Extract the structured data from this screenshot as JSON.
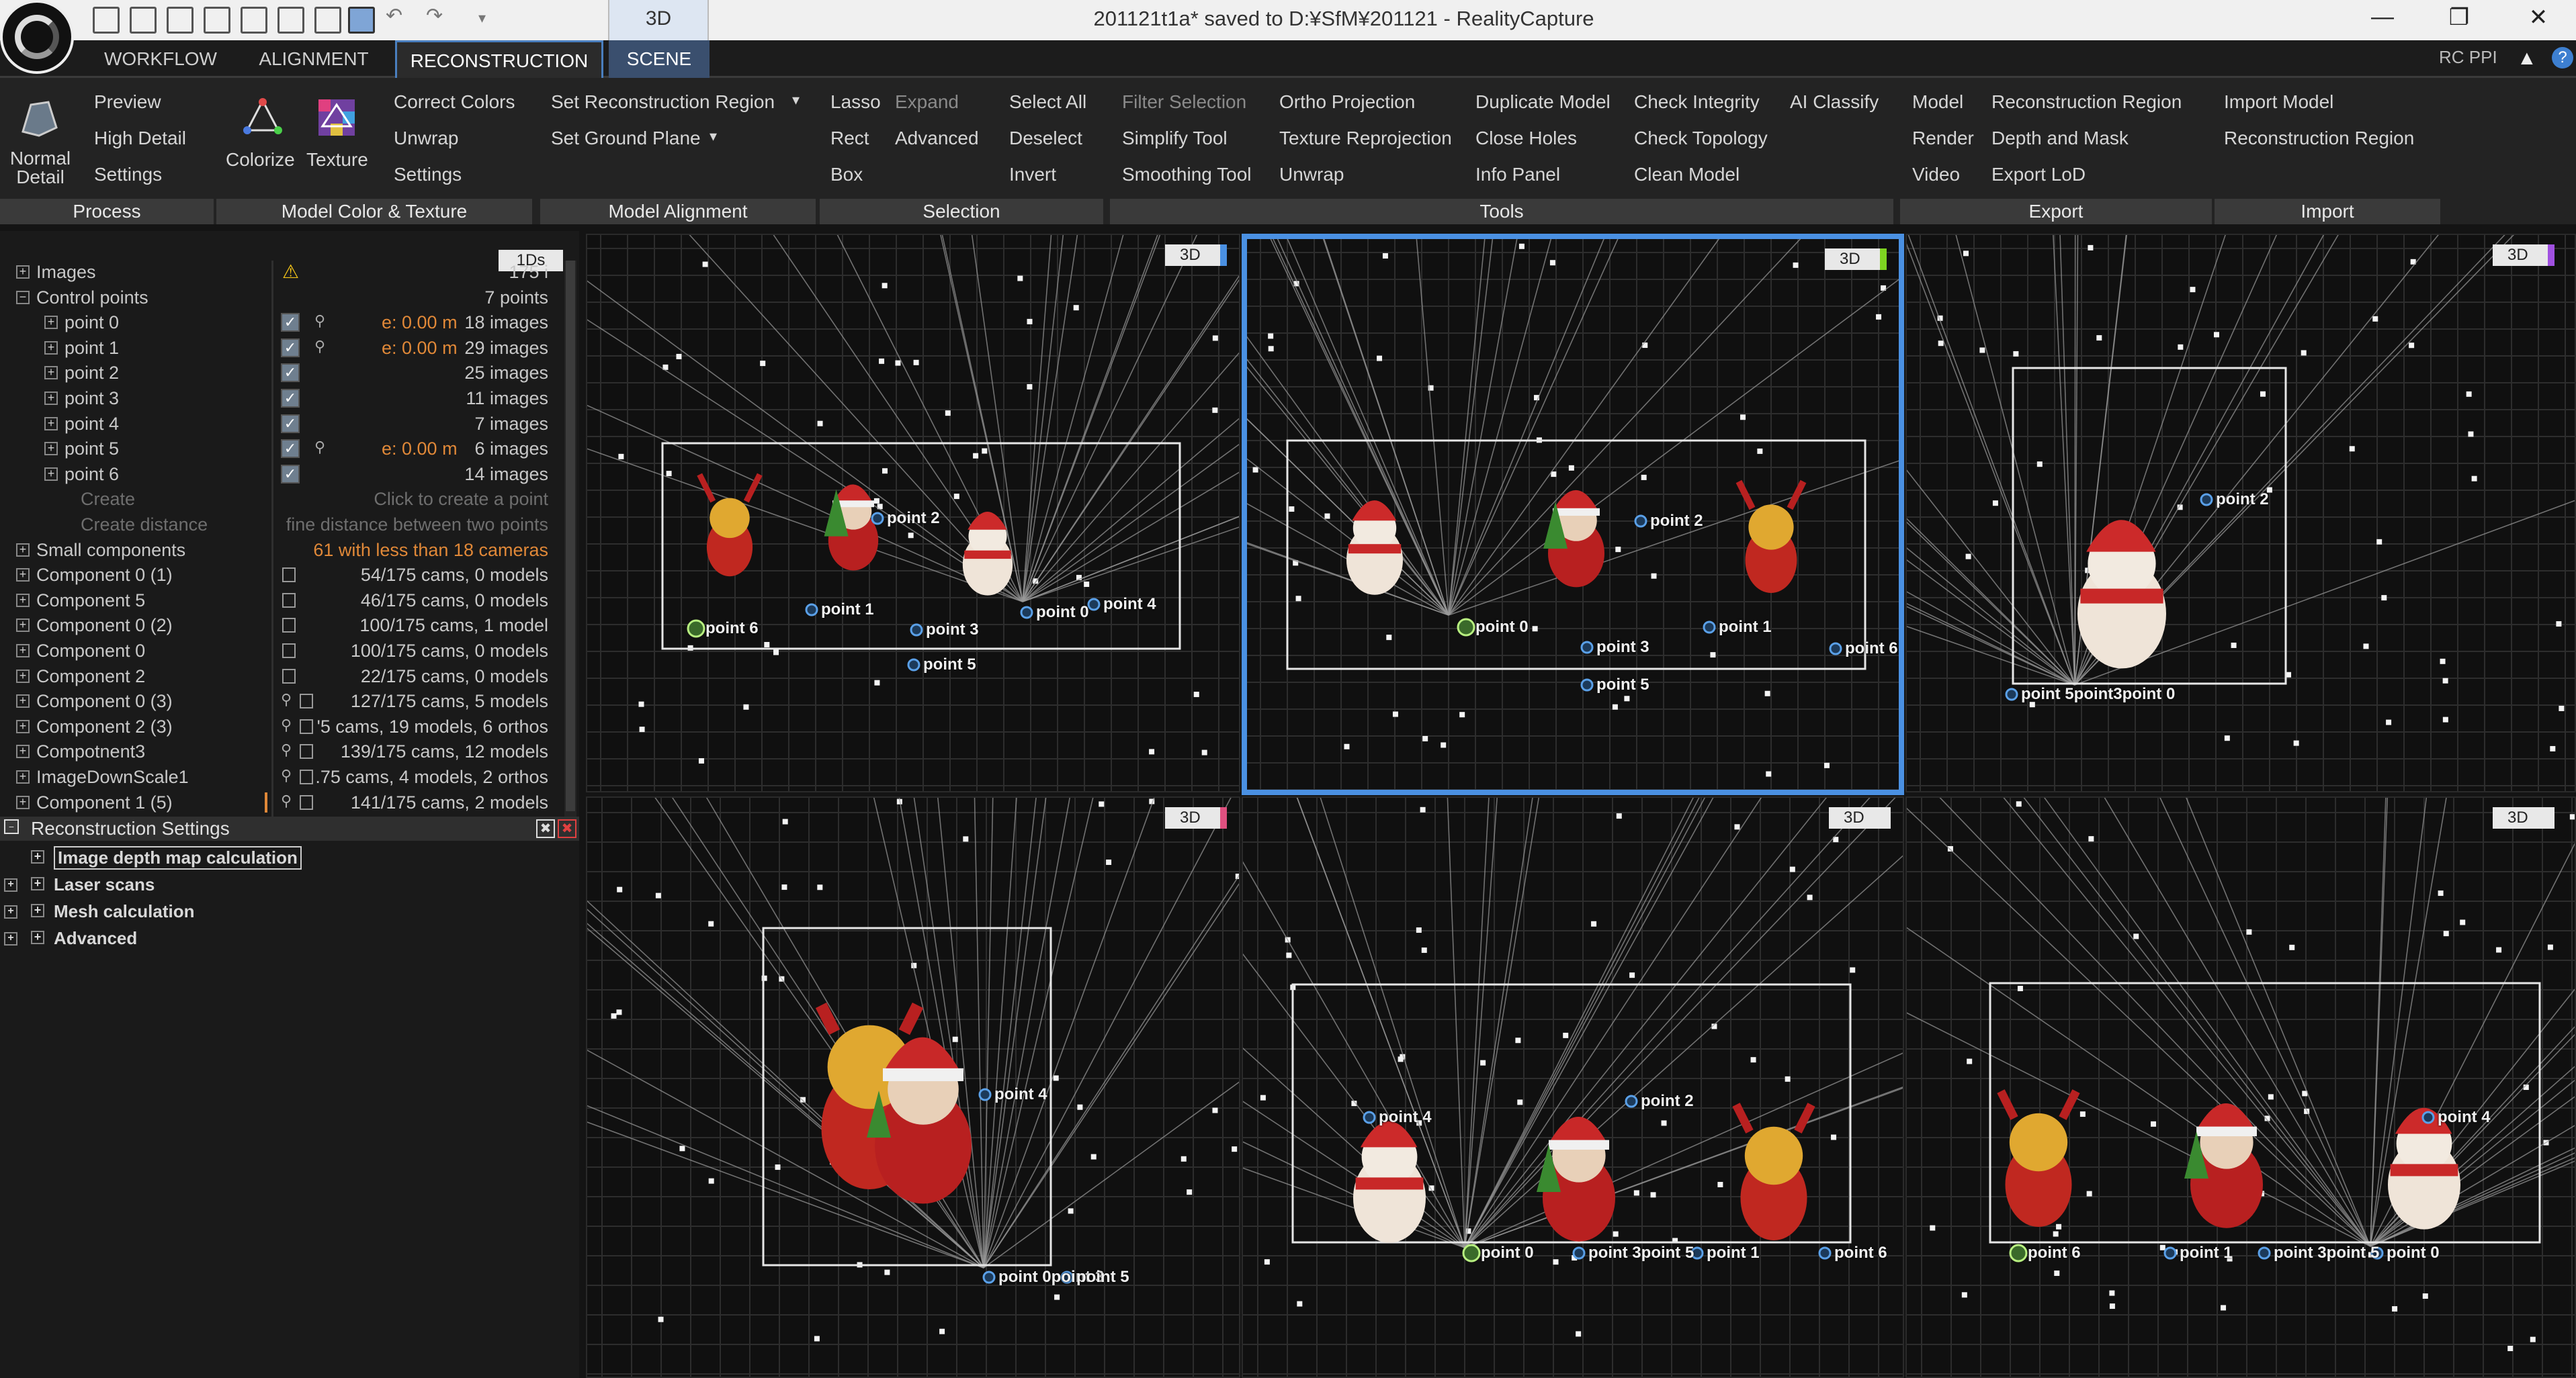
{
  "titlebar": {
    "tab_3d": "3D",
    "window_title": "201121t1a* saved to D:¥SfM¥201121 - RealityCapture",
    "minimize": "—",
    "restore": "❐",
    "close": "✕"
  },
  "menubar": {
    "tabs": [
      "WORKFLOW",
      "ALIGNMENT",
      "RECONSTRUCTION",
      "SCENE"
    ],
    "active_tab": "RECONSTRUCTION",
    "rc_ppi": "RC PPI"
  },
  "ribbon": {
    "process": {
      "normal_detail": "Normal Detail",
      "preview": "Preview",
      "high_detail": "High Detail",
      "settings": "Settings",
      "label": "Process"
    },
    "color_texture": {
      "colorize": "Colorize",
      "texture": "Texture",
      "correct_colors": "Correct Colors",
      "unwrap": "Unwrap",
      "settings": "Settings",
      "label": "Model Color & Texture"
    },
    "alignment": {
      "set_region": "Set Reconstruction Region",
      "set_ground": "Set Ground Plane",
      "label": "Model Alignment"
    },
    "selection": {
      "lasso": "Lasso",
      "expand": "Expand",
      "rect": "Rect",
      "advanced": "Advanced",
      "box": "Box",
      "select_all": "Select All",
      "deselect": "Deselect",
      "invert": "Invert",
      "label": "Selection"
    },
    "tools": {
      "filter_selection": "Filter Selection",
      "simplify": "Simplify Tool",
      "smoothing": "Smoothing Tool",
      "ortho": "Ortho Projection",
      "texture_reprojection": "Texture Reprojection",
      "unwrap": "Unwrap",
      "duplicate": "Duplicate Model",
      "close_holes": "Close Holes",
      "info_panel": "Info Panel",
      "check_integrity": "Check Integrity",
      "check_topology": "Check Topology",
      "clean_model": "Clean Model",
      "ai_classify": "AI Classify",
      "label": "Tools"
    },
    "export": {
      "model": "Model",
      "render": "Render",
      "video": "Video",
      "recon_region": "Reconstruction Region",
      "depth_mask": "Depth and Mask",
      "export_lod": "Export LoD",
      "label": "Export"
    },
    "import": {
      "import_model": "Import Model",
      "recon_region": "Reconstruction Region",
      "label": "Import"
    }
  },
  "tree": {
    "badge": "1Ds",
    "rows": [
      {
        "name": "Images",
        "value": "175 i",
        "indent": 0,
        "kind": "warn",
        "plus": "+"
      },
      {
        "name": "Control points",
        "value": "7 points",
        "indent": 0,
        "kind": "none",
        "plus": "−"
      },
      {
        "name": "point 0",
        "value": "18 images",
        "err": "e: 0.00 m",
        "indent": 1,
        "kind": "cbpin",
        "plus": "+"
      },
      {
        "name": "point 1",
        "value": "29 images",
        "err": "e: 0.00 m",
        "indent": 1,
        "kind": "cbpin",
        "plus": "+"
      },
      {
        "name": "point 2",
        "value": "25 images",
        "indent": 1,
        "kind": "cb",
        "plus": "+"
      },
      {
        "name": "point 3",
        "value": "11 images",
        "indent": 1,
        "kind": "cb",
        "plus": "+"
      },
      {
        "name": "point 4",
        "value": "7 images",
        "indent": 1,
        "kind": "cb",
        "plus": "+"
      },
      {
        "name": "point 5",
        "value": "6 images",
        "err": "e: 0.00 m",
        "indent": 1,
        "kind": "cbpin",
        "plus": "+"
      },
      {
        "name": "point 6",
        "value": "14 images",
        "indent": 1,
        "kind": "cb",
        "plus": "+"
      },
      {
        "name": "Create",
        "value": "Click to create a point",
        "indent": 2,
        "kind": "grey",
        "plus": ""
      },
      {
        "name": "Create distance",
        "value": "fine distance between two points",
        "indent": 2,
        "kind": "grey",
        "plus": ""
      },
      {
        "name": "Small components",
        "value": "61 with less than 18 cameras",
        "indent": 0,
        "kind": "orange",
        "plus": "+"
      },
      {
        "name": "Component 0 (1)",
        "value": "54/175 cams, 0 models",
        "indent": 0,
        "kind": "model",
        "plus": "+"
      },
      {
        "name": "Component 5",
        "value": "46/175 cams, 0 models",
        "indent": 0,
        "kind": "model",
        "plus": "+"
      },
      {
        "name": "Component 0 (2)",
        "value": "100/175 cams, 1 model",
        "indent": 0,
        "kind": "model",
        "plus": "+"
      },
      {
        "name": "Component 0",
        "value": "100/175 cams, 0 models",
        "indent": 0,
        "kind": "model",
        "plus": "+"
      },
      {
        "name": "Component 2",
        "value": "22/175 cams, 0 models",
        "indent": 0,
        "kind": "model",
        "plus": "+"
      },
      {
        "name": "Component 0 (3)",
        "value": "127/175 cams, 5 models",
        "indent": 0,
        "kind": "pinmodel",
        "plus": "+"
      },
      {
        "name": "Component 2 (3)",
        "value": "'5 cams, 19 models, 6 orthos",
        "indent": 0,
        "kind": "pinmodel",
        "plus": "+"
      },
      {
        "name": "Compotnent3",
        "value": "139/175 cams, 12 models",
        "indent": 0,
        "kind": "pinmodel",
        "plus": "+"
      },
      {
        "name": "ImageDownScale1",
        "value": ".75 cams, 4 models, 2 orthos",
        "indent": 0,
        "kind": "pinmodel",
        "plus": "+"
      },
      {
        "name": "Component 1 (5)",
        "value": "141/175 cams, 2 models",
        "indent": 0,
        "kind": "pinmodel",
        "plus": "+"
      }
    ]
  },
  "settings": {
    "title": "Reconstruction Settings",
    "rows": [
      "Image depth map calculation",
      "Laser scans",
      "Mesh calculation",
      "Advanced"
    ]
  },
  "viewports": {
    "badge": "3D",
    "labels": {
      "p0": "point 0",
      "p1": "point 1",
      "p2": "point 2",
      "p3": "point 3",
      "p4": "point 4",
      "p5": "point 5",
      "p6": "point 6",
      "stack_tr": "point 5point3point 0",
      "stack_bl": "point 0point 3",
      "stack_bm": "point 3point 5",
      "stack_br": "point 3point 5"
    }
  },
  "colors": {
    "accent": "#4a90e2",
    "orange": "#e08838",
    "stripe_green": "#7ed321",
    "stripe_blue": "#4a90e2",
    "stripe_purple": "#a050e0",
    "stripe_pink": "#e05080"
  }
}
